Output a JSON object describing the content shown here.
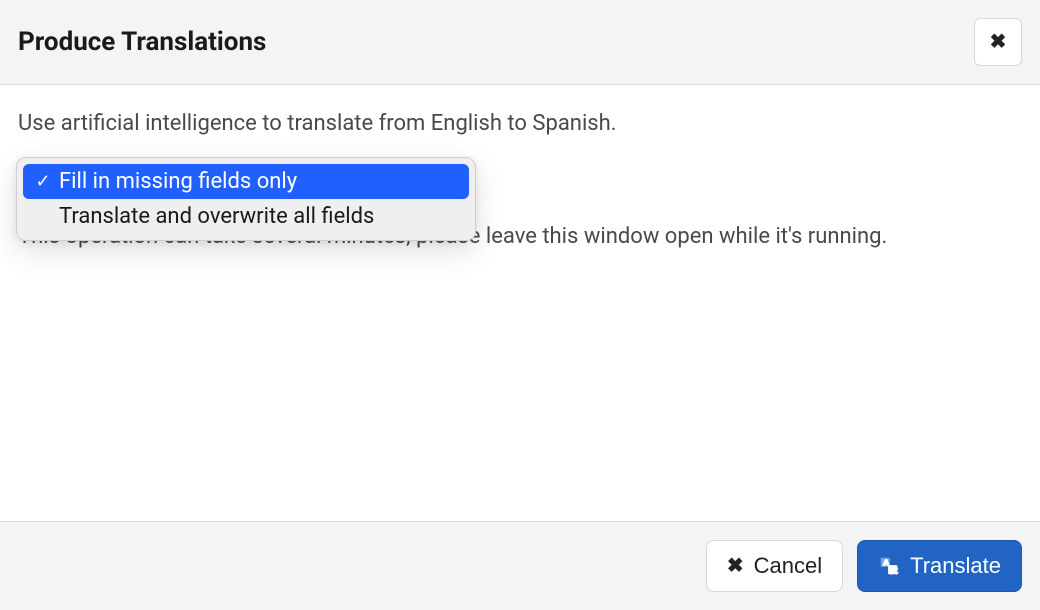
{
  "header": {
    "title": "Produce Translations"
  },
  "body": {
    "intro_text": "Use artificial intelligence to translate from English to Spanish.",
    "help_text": "This operation can take several minutes; please leave this window open while it's running."
  },
  "dropdown": {
    "options": [
      {
        "label": "Fill in missing fields only",
        "selected": true
      },
      {
        "label": "Translate and overwrite all fields",
        "selected": false
      }
    ]
  },
  "footer": {
    "cancel_label": "Cancel",
    "translate_label": "Translate"
  }
}
